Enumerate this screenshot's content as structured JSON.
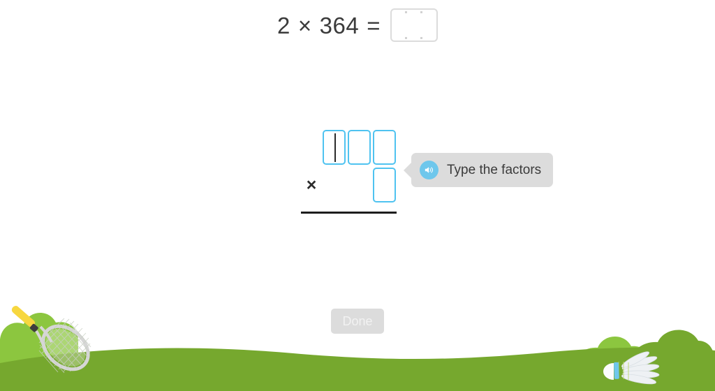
{
  "equation": {
    "left_operand": "2",
    "operator": "×",
    "right_operand": "364",
    "equals": "=",
    "answer_value": "",
    "answer_placeholder": ""
  },
  "workspace": {
    "operator_symbol": "×",
    "factor_row_top": [
      {
        "value": "",
        "has_caret": true
      },
      {
        "value": "",
        "has_caret": false
      },
      {
        "value": "",
        "has_caret": false
      }
    ],
    "factor_row_bottom": [
      {
        "value": "",
        "has_caret": false
      }
    ]
  },
  "tooltip": {
    "text": "Type the factors",
    "audio_icon": "speaker-icon",
    "background_color": "#dcdcdc",
    "icon_color": "#6ec7ec"
  },
  "actions": {
    "done_label": "Done",
    "done_enabled": false
  },
  "scenery": {
    "grass_color": "#76a82e",
    "bush_light_color": "#8cc63f",
    "bush_dark_color": "#76a82e",
    "racket_handle_color": "#f7d73f",
    "racket_frame_color": "#d6d6d6",
    "shuttlecock_color": "#f4f6f8",
    "shuttlecock_band_color": "#6ec7ec"
  },
  "colors": {
    "cell_border": "#4fc3f0",
    "answer_border": "#dcdcdc",
    "text": "#3b3b3b",
    "rule": "#1d1d1d"
  }
}
